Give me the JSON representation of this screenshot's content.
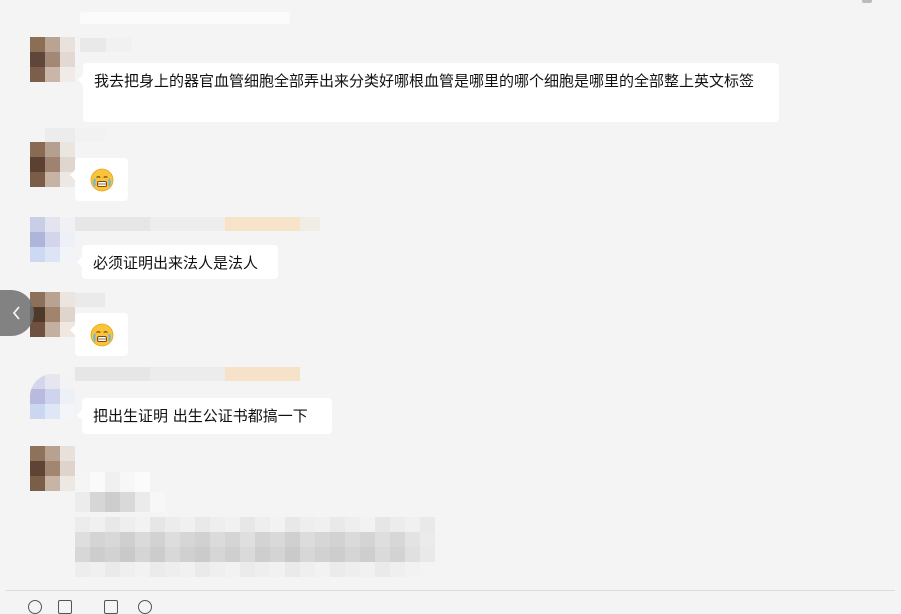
{
  "messages": [
    {
      "type": "text",
      "text": "我去把身上的器官血管细胞全部弄出来分类好哪根血管是哪里的哪个细胞是哪里的全部整上英文标签"
    },
    {
      "type": "emoji",
      "emoji": "crying-face"
    },
    {
      "type": "text",
      "text": "必须证明出来法人是法人"
    },
    {
      "type": "emoji",
      "emoji": "crying-face"
    },
    {
      "type": "text",
      "text": "把出生证明 出生公证书都搞一下"
    },
    {
      "type": "redacted"
    }
  ],
  "icons": {
    "back": "chevron-left-icon",
    "emoji": "crying-face-icon"
  },
  "colors": {
    "background": "#f4f4f4",
    "bubble": "#ffffff",
    "text": "#111111",
    "nav_button": "#6f6f6f"
  }
}
